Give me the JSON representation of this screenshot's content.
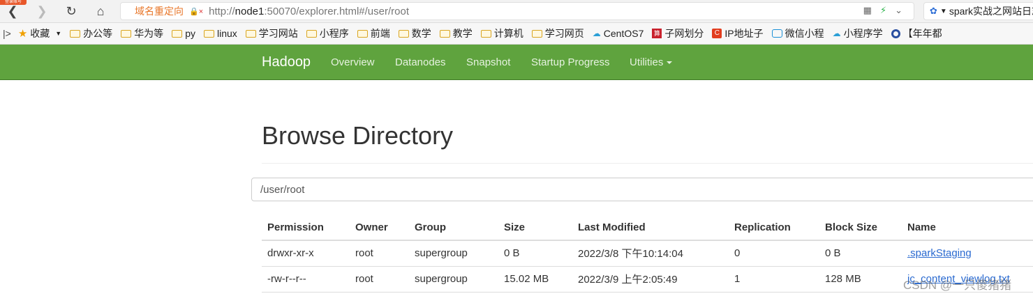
{
  "browser": {
    "corner_badge": "登录账号",
    "address": {
      "redirect_label": "域名重定向",
      "url_prefix": "http://",
      "url_host": "node1",
      "url_rest": ":50070/explorer.html#/user/root"
    },
    "search_text": "spark实战之网站日志",
    "bookmarks": [
      {
        "icon": "star-icon",
        "label": "收藏"
      },
      {
        "icon": "folder-icon",
        "label": "办公等"
      },
      {
        "icon": "folder-icon",
        "label": "华为等"
      },
      {
        "icon": "folder-icon",
        "label": "py"
      },
      {
        "icon": "folder-icon",
        "label": "linux"
      },
      {
        "icon": "folder-icon",
        "label": "学习网站"
      },
      {
        "icon": "folder-icon",
        "label": "小程序"
      },
      {
        "icon": "folder-icon",
        "label": "前端"
      },
      {
        "icon": "folder-icon",
        "label": "数学"
      },
      {
        "icon": "folder-icon",
        "label": "教学"
      },
      {
        "icon": "folder-icon",
        "label": "计算机"
      },
      {
        "icon": "folder-icon",
        "label": "学习网页"
      },
      {
        "icon": "cloud-icon",
        "label": "CentOS7"
      },
      {
        "icon": "red-square-icon",
        "label": "子网划分"
      },
      {
        "icon": "orange-c-icon",
        "label": "IP地址子"
      },
      {
        "icon": "tv-icon",
        "label": "微信小程"
      },
      {
        "icon": "cloud-icon",
        "label": "小程序学"
      },
      {
        "icon": "circle-icon",
        "label": "【年年都"
      }
    ]
  },
  "navbar": {
    "brand": "Hadoop",
    "items": [
      "Overview",
      "Datanodes",
      "Snapshot",
      "Startup Progress",
      "Utilities"
    ]
  },
  "page": {
    "title": "Browse Directory",
    "path_value": "/user/root"
  },
  "table": {
    "headers": [
      "Permission",
      "Owner",
      "Group",
      "Size",
      "Last Modified",
      "Replication",
      "Block Size",
      "Name"
    ],
    "rows": [
      [
        "drwxr-xr-x",
        "root",
        "supergroup",
        "0 B",
        "2022/3/8 下午10:14:04",
        "0",
        "0 B",
        ".sparkStaging"
      ],
      [
        "-rw-r--r--",
        "root",
        "supergroup",
        "15.02 MB",
        "2022/3/9 上午2:05:49",
        "1",
        "128 MB",
        "jc_content_viewlog.txt"
      ]
    ]
  },
  "watermark": "CSDN @一只傻猪猪"
}
